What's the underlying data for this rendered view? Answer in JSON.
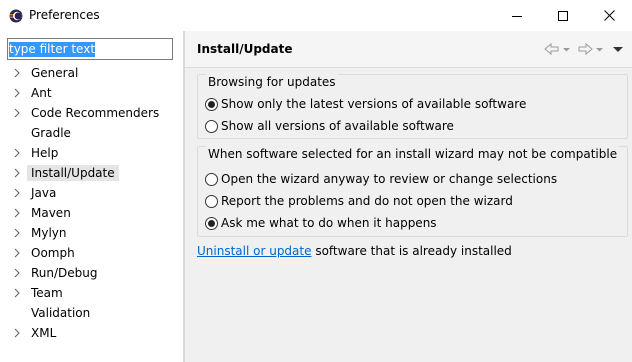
{
  "window": {
    "title": "Preferences"
  },
  "filter": {
    "value": "type filter text"
  },
  "tree": [
    {
      "label": "General",
      "expandable": true
    },
    {
      "label": "Ant",
      "expandable": true
    },
    {
      "label": "Code Recommenders",
      "expandable": true
    },
    {
      "label": "Gradle",
      "expandable": false
    },
    {
      "label": "Help",
      "expandable": true
    },
    {
      "label": "Install/Update",
      "expandable": true,
      "selected": true
    },
    {
      "label": "Java",
      "expandable": true
    },
    {
      "label": "Maven",
      "expandable": true
    },
    {
      "label": "Mylyn",
      "expandable": true
    },
    {
      "label": "Oomph",
      "expandable": true
    },
    {
      "label": "Run/Debug",
      "expandable": true
    },
    {
      "label": "Team",
      "expandable": true
    },
    {
      "label": "Validation",
      "expandable": false
    },
    {
      "label": "XML",
      "expandable": true
    }
  ],
  "page": {
    "title": "Install/Update",
    "browsing": {
      "title": "Browsing for updates",
      "options": [
        {
          "label": "Show only the latest versions of available software",
          "checked": true
        },
        {
          "label": "Show all versions of available software",
          "checked": false
        }
      ]
    },
    "compat": {
      "title": "When software selected for an install wizard may not be compatible",
      "options": [
        {
          "label": "Open the wizard anyway to review or change selections",
          "checked": false
        },
        {
          "label": "Report the problems and do not open the wizard",
          "checked": false
        },
        {
          "label": "Ask me what to do when it happens",
          "checked": true
        }
      ]
    },
    "link_text": "Uninstall or update",
    "link_suffix": " software that is already installed"
  },
  "colors": {
    "selection": "#3399ff",
    "link": "#0066cc",
    "tree_selected": "#e5e5e5"
  },
  "icons": [
    "eclipse-icon",
    "minimize-icon",
    "maximize-icon",
    "close-icon",
    "back-icon",
    "forward-icon",
    "menu-icon"
  ]
}
